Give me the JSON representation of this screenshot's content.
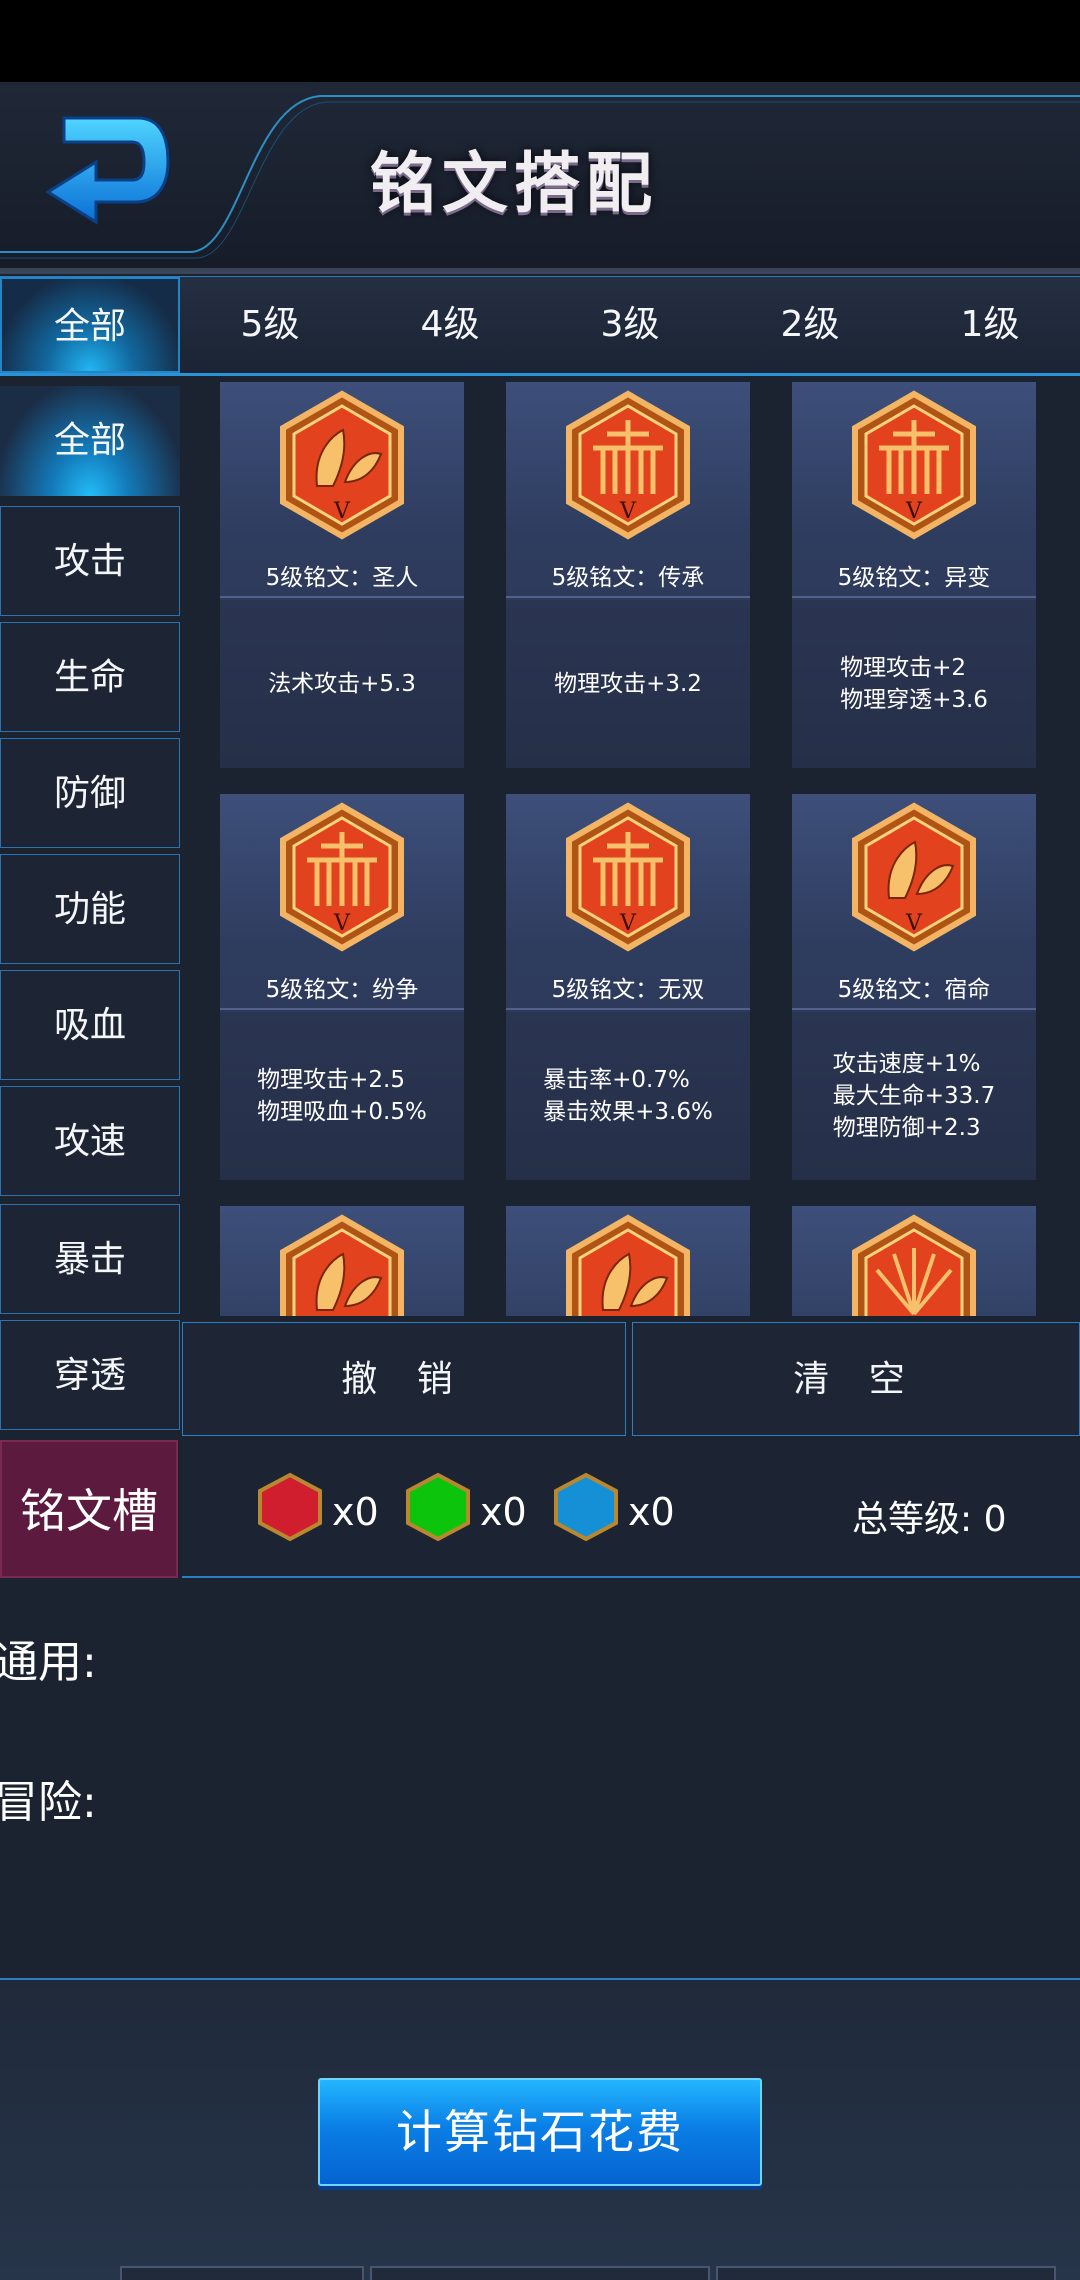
{
  "header": {
    "title": "铭文搭配"
  },
  "level_tabs": [
    "全部",
    "5级",
    "4级",
    "3级",
    "2级",
    "1级"
  ],
  "category_tabs": [
    "全部",
    "攻击",
    "生命",
    "防御",
    "功能",
    "吸血",
    "攻速",
    "暴击",
    "穿透"
  ],
  "inscriptions": [
    {
      "name": "5级铭文：圣人",
      "stats": [
        "法术攻击+5.3"
      ],
      "icon": "butterfly-hexagon-icon",
      "icon_numeral": "V"
    },
    {
      "name": "5级铭文：传承",
      "stats": [
        "物理攻击+3.2"
      ],
      "icon": "pillar-hexagon-icon",
      "icon_numeral": "V"
    },
    {
      "name": "5级铭文：异变",
      "stats": [
        "物理攻击+2",
        "物理穿透+3.6"
      ],
      "icon": "pillar-hexagon-icon",
      "icon_numeral": "V"
    },
    {
      "name": "5级铭文：纷争",
      "stats": [
        "物理攻击+2.5",
        "物理吸血+0.5%"
      ],
      "icon": "pillar-hexagon-icon",
      "icon_numeral": "V"
    },
    {
      "name": "5级铭文：无双",
      "stats": [
        "暴击率+0.7%",
        "暴击效果+3.6%"
      ],
      "icon": "pillar-hexagon-icon",
      "icon_numeral": "V"
    },
    {
      "name": "5级铭文：宿命",
      "stats": [
        "攻击速度+1%",
        "最大生命+33.7",
        "物理防御+2.3"
      ],
      "icon": "butterfly-hexagon-icon",
      "icon_numeral": "V"
    }
  ],
  "actions": {
    "undo_label": "撤 销",
    "clear_label": "清 空"
  },
  "slots": {
    "label": "铭文槽",
    "red_count": "x0",
    "green_count": "x0",
    "blue_count": "x0",
    "total_level": "总等级: 0",
    "colors": {
      "red": "#d01e2e",
      "green": "#0cc40c",
      "blue": "#1590d6"
    }
  },
  "stats": {
    "general_label": "通用:",
    "adventure_label": "冒险:"
  },
  "calculate_button": "计算钻石花费"
}
